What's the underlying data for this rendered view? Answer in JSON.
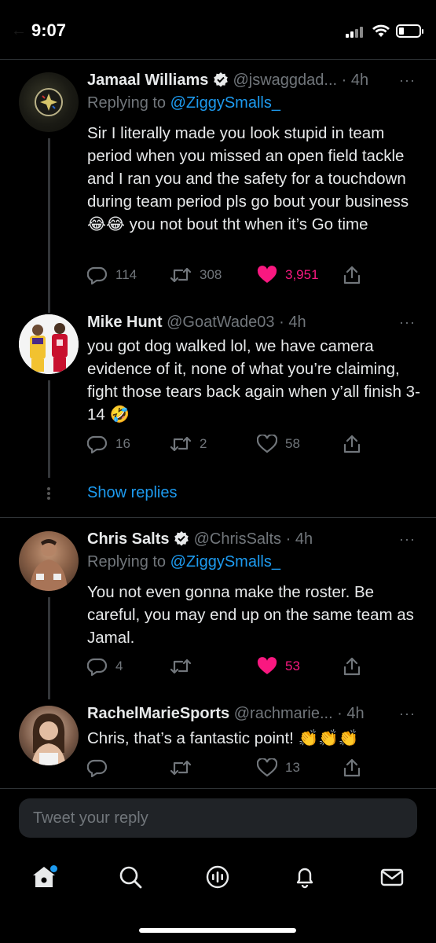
{
  "status_bar": {
    "time": "9:07"
  },
  "colors": {
    "accent": "#1d9bf0",
    "like": "#f91880",
    "muted": "#71767b",
    "background": "#000000"
  },
  "tweets": [
    {
      "name": "Jamaal Williams",
      "verified": true,
      "handle": "@jswaggdad...",
      "time": "4h",
      "replying_prefix": "Replying to ",
      "replying_to": "@ZiggySmalls_",
      "text": "Sir I literally made you look stupid in team period when you missed an open field tackle and I ran you and the safety for a touchdown during team period pls go bout your business 😂😂  you not bout tht when it’s Go time",
      "replies": "114",
      "retweets": "308",
      "likes": "3,951",
      "liked": true
    },
    {
      "name": "Mike Hunt",
      "verified": false,
      "handle": "@GoatWade03",
      "time": "4h",
      "text": "you got dog walked lol, we have camera evidence of it, none of what you’re claiming, fight those tears back again when y’all finish 3-14 🤣",
      "replies": "16",
      "retweets": "2",
      "likes": "58",
      "liked": false
    },
    {
      "name": "Chris Salts",
      "verified": false,
      "handle": "@ChrisSalts",
      "time": "4h",
      "replying_prefix": "Replying to ",
      "replying_to": "@ZiggySmalls_",
      "text": "You not even gonna make the roster. Be careful, you may end up on the same team as Jamal.",
      "replies": "4",
      "retweets": "",
      "likes": "53",
      "liked": true
    },
    {
      "name": "RachelMarieSports",
      "verified": false,
      "handle": "@rachmarie...",
      "time": "4h",
      "text": "Chris, that’s a fantastic point! 👏👏👏",
      "replies": "",
      "retweets": "",
      "likes": "13",
      "liked": false
    }
  ],
  "show_replies": "Show replies",
  "more_glyph": "···",
  "separator": " · ",
  "reply_box": {
    "placeholder": "Tweet your reply"
  },
  "nav": [
    "home-icon",
    "search-icon",
    "spaces-icon",
    "notifications-icon",
    "messages-icon"
  ]
}
